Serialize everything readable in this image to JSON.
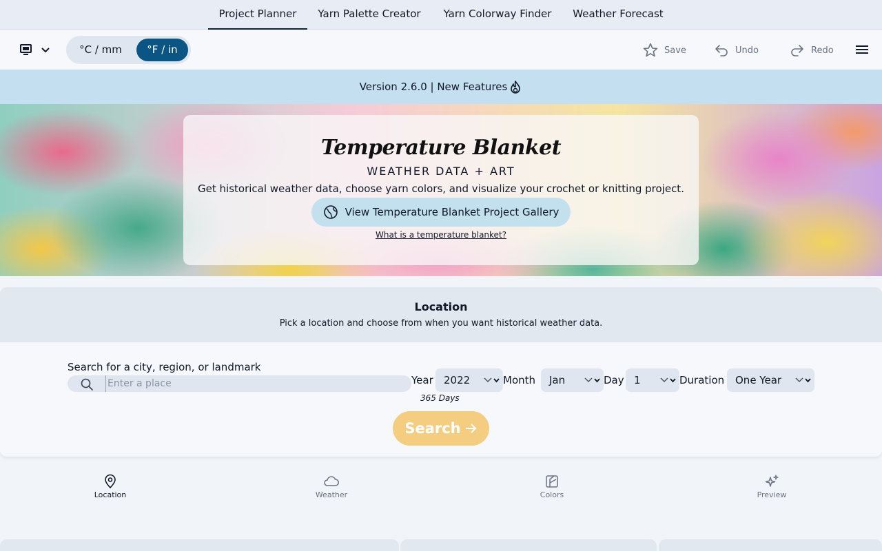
{
  "nav": {
    "tabs": [
      {
        "label": "Project Planner",
        "active": true
      },
      {
        "label": "Yarn Palette Creator",
        "active": false
      },
      {
        "label": "Yarn Colorway Finder",
        "active": false
      },
      {
        "label": "Weather Forecast",
        "active": false
      }
    ]
  },
  "toolbar": {
    "device_icon": "monitor-icon",
    "units": {
      "celsius": "°C / mm",
      "fahrenheit": "°F / in",
      "selected": "fahrenheit"
    },
    "save_label": "Save",
    "undo_label": "Undo",
    "redo_label": "Redo"
  },
  "banner": {
    "text": "Version 2.6.0 | New Features",
    "icon": "flame-icon"
  },
  "hero": {
    "title": "Temperature Blanket",
    "subtitle": "WEATHER DATA + ART",
    "description": "Get historical weather data, choose yarn colors, and visualize your crochet or knitting project.",
    "gallery_button": "View Temperature Blanket Project Gallery",
    "what_link": "What is a temperature blanket?"
  },
  "location": {
    "title": "Location",
    "subtitle": "Pick a location and choose from when you want historical weather data.",
    "search_label": "Search for a city, region, or landmark",
    "search_placeholder": "Enter a place",
    "search_value": "",
    "year_label": "Year",
    "year_value": "2022",
    "month_label": "Month",
    "month_value": "Jan",
    "day_label": "Day",
    "day_value": "1",
    "duration_label": "Duration",
    "duration_value": "One Year",
    "days_note": "365 Days",
    "search_button": "Search"
  },
  "steps": [
    {
      "label": "Location",
      "icon": "map-pin-icon",
      "active": true
    },
    {
      "label": "Weather",
      "icon": "cloud-icon",
      "active": false
    },
    {
      "label": "Colors",
      "icon": "palette-icon",
      "active": false
    },
    {
      "label": "Preview",
      "icon": "sparkles-icon",
      "active": false
    }
  ],
  "colors": {
    "accent": "#0a5583",
    "banner": "#c4dff0",
    "search_button": "#f4cd80",
    "gallery_button": "#c3e0ee"
  }
}
